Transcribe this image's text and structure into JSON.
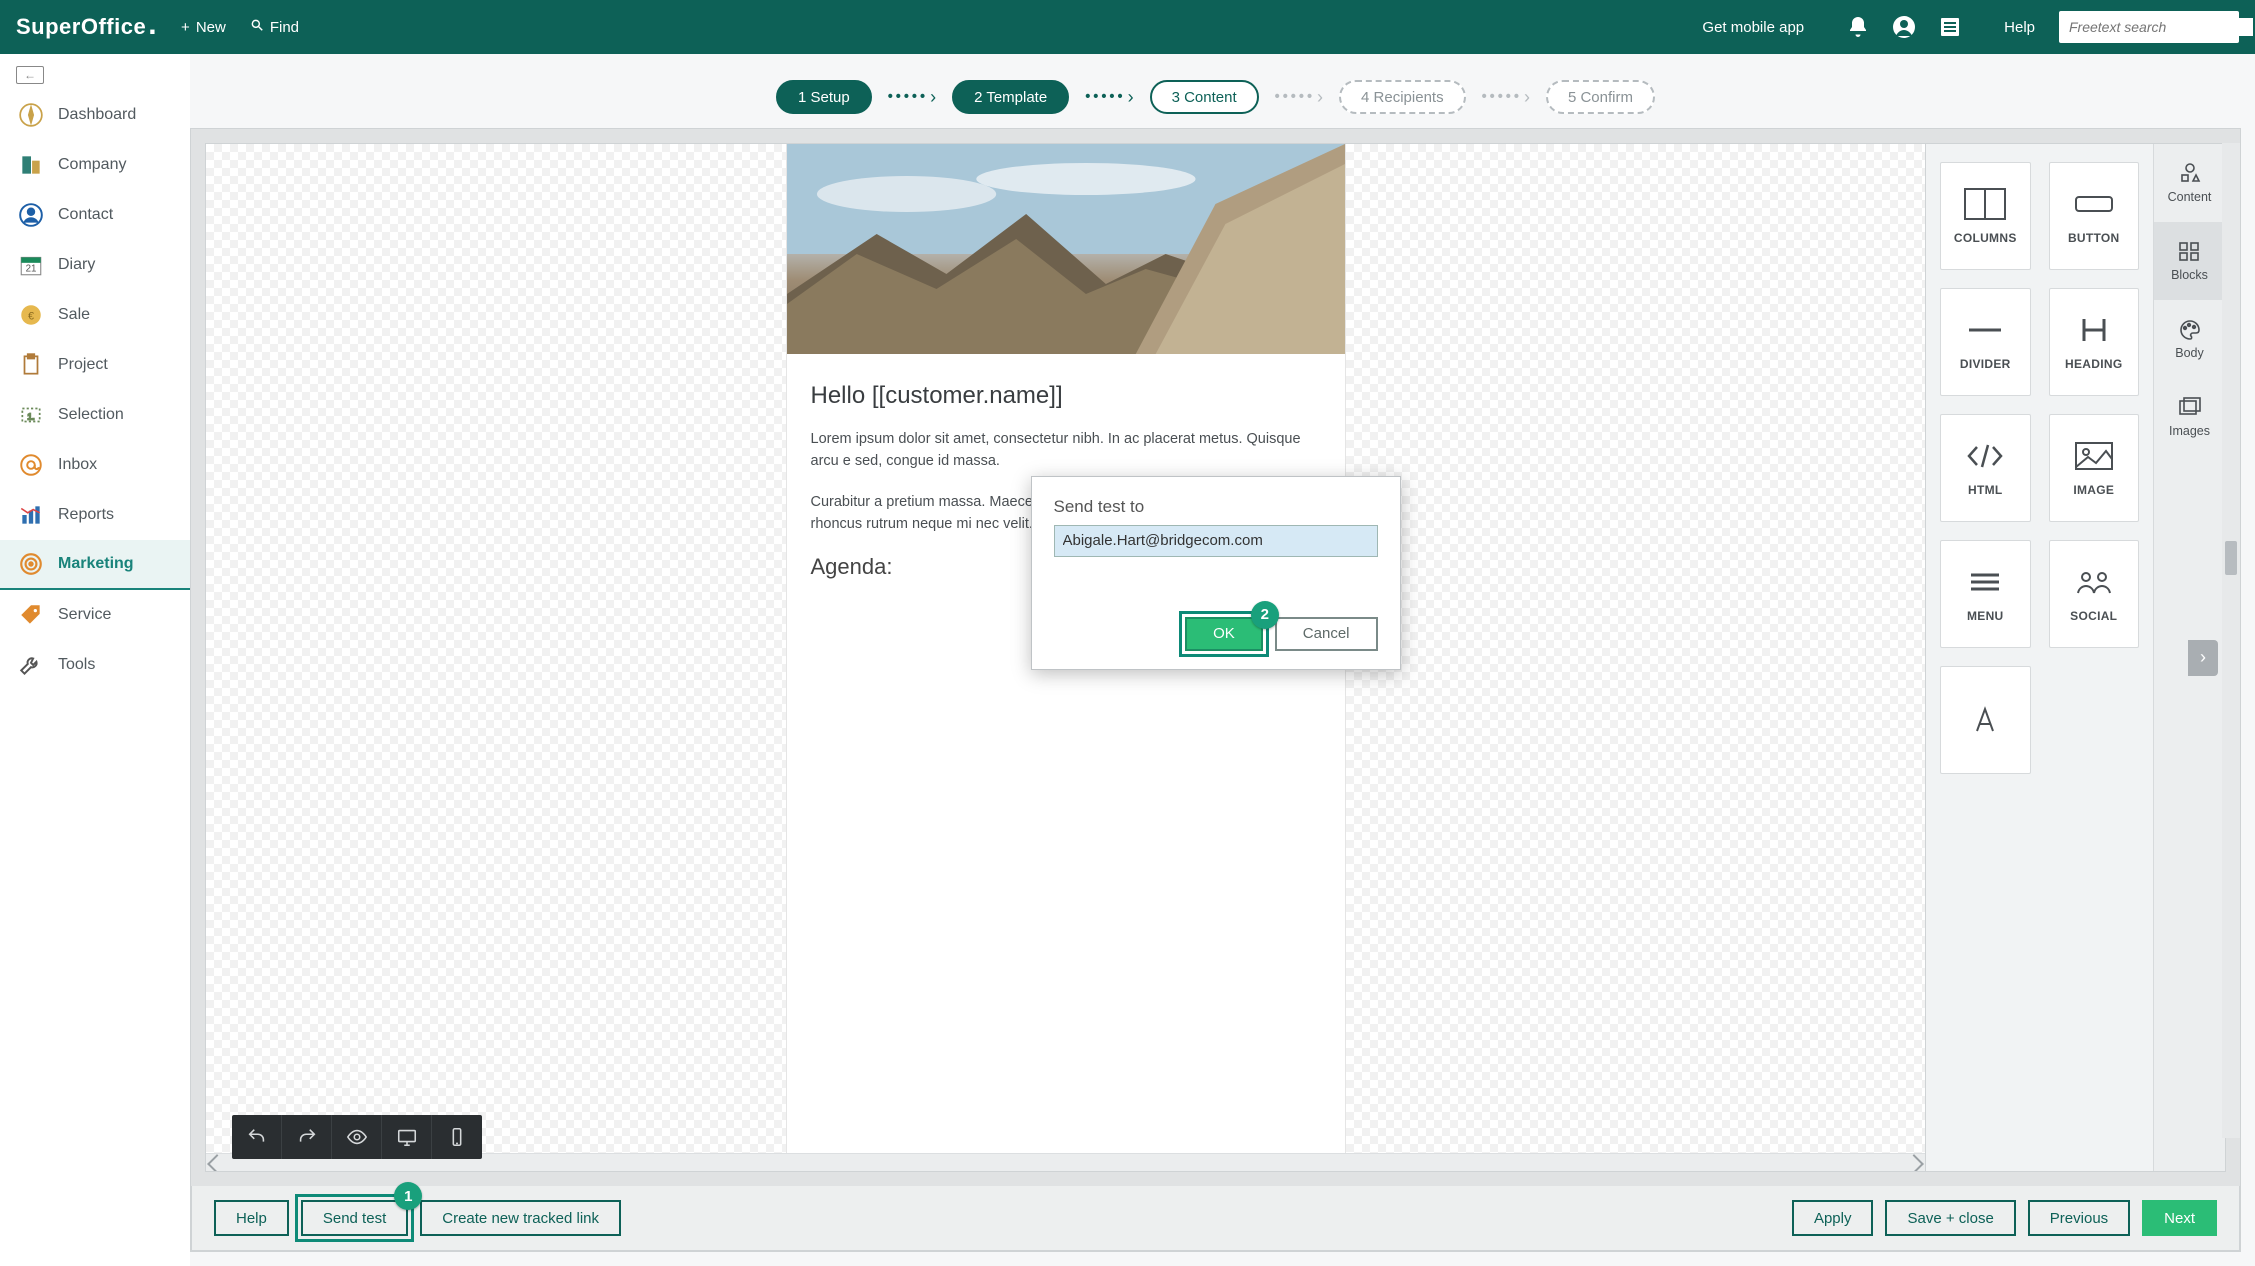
{
  "header": {
    "logo": "SuperOffice",
    "new": "New",
    "find": "Find",
    "mobile": "Get mobile app",
    "help": "Help",
    "search_placeholder": "Freetext search"
  },
  "sidenav": {
    "items": [
      {
        "label": "Dashboard"
      },
      {
        "label": "Company"
      },
      {
        "label": "Contact"
      },
      {
        "label": "Diary"
      },
      {
        "label": "Sale"
      },
      {
        "label": "Project"
      },
      {
        "label": "Selection"
      },
      {
        "label": "Inbox"
      },
      {
        "label": "Reports"
      },
      {
        "label": "Marketing"
      },
      {
        "label": "Service"
      },
      {
        "label": "Tools"
      }
    ],
    "active_index": 9
  },
  "wizard": {
    "steps": [
      {
        "label": "1 Setup",
        "state": "done"
      },
      {
        "label": "2 Template",
        "state": "done"
      },
      {
        "label": "3 Content",
        "state": "current"
      },
      {
        "label": "4 Recipients",
        "state": "pending"
      },
      {
        "label": "5 Confirm",
        "state": "pending"
      }
    ]
  },
  "email": {
    "greeting": "Hello [[customer.name]]",
    "para1": "Lorem ipsum dolor sit amet, consectetur nibh. In ac placerat metus. Quisque arcu e sed, congue id massa.",
    "para2": "Curabitur a pretium massa. Maecenas pha tristique, justo sem interdum risus, rhoncus rutrum neque mi nec velit.",
    "agenda": "Agenda:"
  },
  "blocks": {
    "tiles": [
      {
        "label": "COLUMNS"
      },
      {
        "label": "BUTTON"
      },
      {
        "label": "DIVIDER"
      },
      {
        "label": "HEADING"
      },
      {
        "label": "HTML"
      },
      {
        "label": "IMAGE"
      },
      {
        "label": "MENU"
      },
      {
        "label": "SOCIAL"
      }
    ],
    "tabs": [
      {
        "label": "Content"
      },
      {
        "label": "Blocks"
      },
      {
        "label": "Body"
      },
      {
        "label": "Images"
      }
    ],
    "active_tab": 1
  },
  "actions": {
    "help": "Help",
    "send_test": "Send test",
    "create_link": "Create new tracked link",
    "apply": "Apply",
    "save_close": "Save + close",
    "previous": "Previous",
    "next": "Next"
  },
  "modal": {
    "title": "Send test to",
    "value": "Abigale.Hart@bridgecom.com",
    "ok": "OK",
    "cancel": "Cancel"
  },
  "callouts": {
    "one": "1",
    "two": "2"
  }
}
